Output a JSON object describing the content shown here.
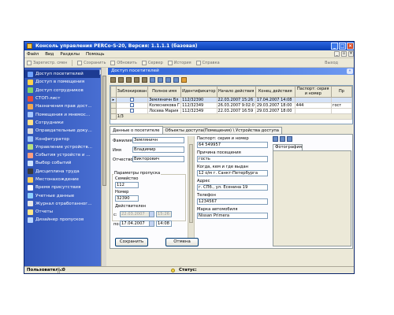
{
  "window": {
    "title": "Консоль управления PERCo-S-20, Версия: 1.1.1.1 (базовая)"
  },
  "menu": [
    "Файл",
    "Вид",
    "Разделы",
    "Помощь"
  ],
  "toolbar": {
    "items": [
      "Зарегистр. смен",
      "Сохранить",
      "Обновить",
      "Сервер",
      "История",
      "Справка"
    ],
    "help": "Выход"
  },
  "sidebar": {
    "items": [
      {
        "label": "Доступ посетителей",
        "icon": "visitor-access-icon",
        "color": "#6fa3ff"
      },
      {
        "label": "Доступ в помещения",
        "icon": "room-access-icon",
        "color": "#ffd24d"
      },
      {
        "label": "Доступ сотрудников",
        "icon": "employee-access-icon",
        "color": "#7fd36b"
      },
      {
        "label": "СТОП-лист",
        "icon": "stop-list-icon",
        "color": "#e64a3b"
      },
      {
        "label": "Назначения прав дост...",
        "icon": "access-rights-icon",
        "color": "#f0a850"
      },
      {
        "label": "Помещения и мнемос...",
        "icon": "rooms-icon",
        "color": "#a6c8ff"
      },
      {
        "label": "Сотрудники",
        "icon": "employees-icon",
        "color": "#ffe08a"
      },
      {
        "label": "Оправдательные доку...",
        "icon": "documents-icon",
        "color": "#d8d8d8"
      },
      {
        "label": "Конфигуратор",
        "icon": "configurator-icon",
        "color": "#9cc6ff"
      },
      {
        "label": "Управление устройств...",
        "icon": "device-control-icon",
        "color": "#b7e07f"
      },
      {
        "label": "События устройств и ...",
        "icon": "device-events-icon",
        "color": "#ff9f7f"
      },
      {
        "label": "Выбор событий",
        "icon": "event-select-icon",
        "color": "#cfe3ff"
      },
      {
        "label": "Дисциплина труда",
        "icon": "labor-discipline-icon",
        "color": "#3a3a3a"
      },
      {
        "label": "Местонахождение",
        "icon": "location-icon",
        "color": "#ffcf5a"
      },
      {
        "label": "Время присутствия",
        "icon": "presence-time-icon",
        "color": "#ffffff"
      },
      {
        "label": "Учетные данные",
        "icon": "credentials-icon",
        "color": "#8fd0ff"
      },
      {
        "label": "Журнал отработанног...",
        "icon": "work-log-icon",
        "color": "#e7e7e7"
      },
      {
        "label": "Отчеты",
        "icon": "reports-icon",
        "color": "#ffe68a"
      },
      {
        "label": "Дизайнер пропусков",
        "icon": "pass-designer-icon",
        "color": "#b9d6ff"
      }
    ]
  },
  "panel": {
    "title": "Доступ посетителей",
    "grid": {
      "columns": [
        "Заблокирован",
        "Полное имя",
        "Идентификатор",
        "Начало действия",
        "Конец действия",
        "Паспорт: серия и номер",
        "Пр"
      ],
      "rows": [
        {
          "name": "Земляничн Вл",
          "id": "112/32390",
          "start": "22.03.2007 15:26",
          "end": "17.04.2007 14:08",
          "passport": "",
          "extra": ""
        },
        {
          "name": "Колесникова Г",
          "id": "112/32349",
          "start": "26.03.2007 9:02:0",
          "end": "29.03.2007 18:00",
          "passport": "444",
          "extra": "гост"
        },
        {
          "name": "Лосева Мария",
          "id": "112/32349",
          "start": "22.03.2007 16:59",
          "end": "29.03.2007 18:00",
          "passport": "",
          "extra": ""
        }
      ],
      "count": "1/3"
    },
    "tabs": [
      "Данные о посетителе",
      "Объекты доступа(Помещения) \\ Устройства доступа"
    ],
    "form": {
      "surname_label": "Фамилия",
      "surname": "Земляничн",
      "name_label": "Имя",
      "name": "Владимир",
      "patronymic_label": "Отчество",
      "patronymic": "Викторович",
      "pass_group": "Параметры пропуска",
      "family_label": "Семейство",
      "family": "112",
      "number_label": "Номер",
      "number": "32390",
      "valid_label": "Действителен",
      "from_label": "с:",
      "from_date": "22.03.2007",
      "from_time": "15:26",
      "to_label": "по:",
      "to_date": "17.04.2007",
      "to_time": "14:08",
      "passport_label": "Паспорт: серия и номер",
      "passport": "64 549957",
      "reason_label": "Причина посещения",
      "reason": "гость",
      "issued_label": "Когда, кем и где выдан",
      "issued": "12 о/м г. Санкт-Петербурга",
      "address_label": "Адрес",
      "address": "г. СПб., ул. Есенина 19",
      "phone_label": "Телефон",
      "phone": "1234567",
      "car_label": "Марка автомобиля",
      "car": "Nissan Primera",
      "photo_tab": "Фотография"
    },
    "save_button": "Сохранить",
    "cancel_button": "Отмена"
  },
  "status": {
    "user_label": "Пользователь:",
    "user_value": "0",
    "status_label": "Статус:"
  },
  "colors": {
    "title_bar": "#0a3fb3",
    "sidebar": "#3a60c4",
    "panel_header": "#2a5fd6",
    "selection": "#d6e3f7"
  }
}
